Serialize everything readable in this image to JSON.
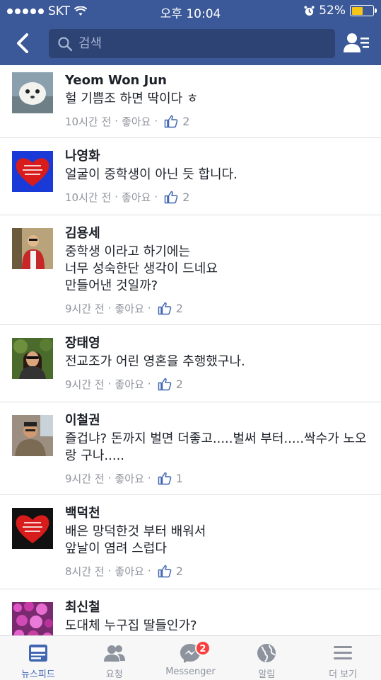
{
  "status_bar": {
    "carrier": "SKT",
    "time": "오후 10:04",
    "battery_percent": "52%",
    "battery_level": 0.52,
    "battery_color": "#f5c518"
  },
  "nav": {
    "back_icon": "chevron-left-icon",
    "search_placeholder": "검색",
    "friends_icon": "friend-list-icon",
    "bar_color": "#3b5998"
  },
  "comments": [
    {
      "name": "Yeom Won Jun",
      "text": "헐 기쁨조 하면 딱이다 ㅎ",
      "time": "10시간 전",
      "like_label": "좋아요",
      "likes": "2",
      "avatar": "seal-photo"
    },
    {
      "name": "나영화",
      "text": "얼굴이 중학생이 아닌 듯 합니다.",
      "time": "10시간 전",
      "like_label": "좋아요",
      "likes": "2",
      "avatar": "red-heart-photo"
    },
    {
      "name": "김용세",
      "text": "중학생 이라고 하기에는\n너무 성숙한단 생각이 드네요\n만들어낸 것일까?",
      "time": "9시간 전",
      "like_label": "좋아요",
      "likes": "2",
      "avatar": "man-photo"
    },
    {
      "name": "장태영",
      "text": "전교조가 어린 영혼을 추행했구나.",
      "time": "9시간 전",
      "like_label": "좋아요",
      "likes": "2",
      "avatar": "woman-sunglasses-photo"
    },
    {
      "name": "이철권",
      "text": "즐겁냐? 돈까지 벌면 더좋고.....벌써 부터.....싹수가 노오랑 구나.....",
      "time": "9시간 전",
      "like_label": "좋아요",
      "likes": "1",
      "avatar": "man-photo"
    },
    {
      "name": "백덕천",
      "text": "배은 망덕한것 부터 배워서\n앞날이  염려 스럽다",
      "time": "8시간 전",
      "like_label": "좋아요",
      "likes": "2",
      "avatar": "red-heart-photo"
    },
    {
      "name": "최신철",
      "text": "도대체  누구집  딸들인가?",
      "time": "",
      "like_label": "",
      "likes": "",
      "avatar": "flowers-photo"
    }
  ],
  "tabbar": {
    "tabs": [
      {
        "label": "뉴스피드",
        "icon": "news-feed-icon",
        "active": true
      },
      {
        "label": "요청",
        "icon": "friend-requests-icon",
        "active": false
      },
      {
        "label": "Messenger",
        "icon": "messenger-icon",
        "active": false,
        "badge": "2"
      },
      {
        "label": "알림",
        "icon": "globe-icon",
        "active": false
      },
      {
        "label": "더 보기",
        "icon": "menu-icon",
        "active": false
      }
    ],
    "active_color": "#4267b2",
    "inactive_color": "#8d949e"
  }
}
